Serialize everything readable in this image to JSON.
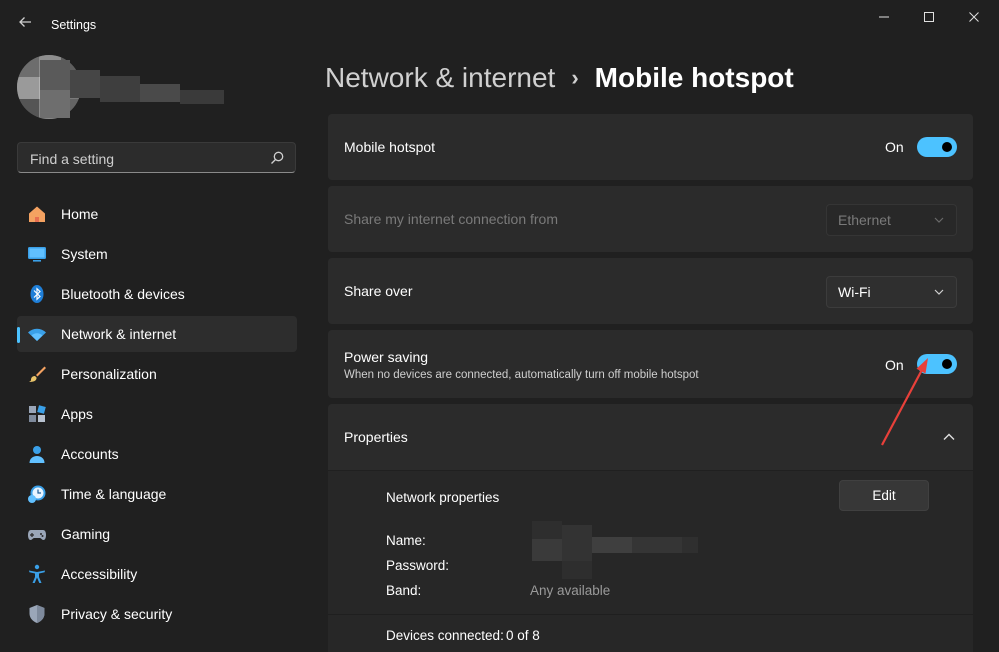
{
  "window": {
    "title": "Settings"
  },
  "search": {
    "placeholder": "Find a setting"
  },
  "sidebar": {
    "items": [
      {
        "label": "Home",
        "icon": "home-icon"
      },
      {
        "label": "System",
        "icon": "monitor-icon"
      },
      {
        "label": "Bluetooth & devices",
        "icon": "bluetooth-icon"
      },
      {
        "label": "Network & internet",
        "icon": "wifi-icon",
        "selected": true
      },
      {
        "label": "Personalization",
        "icon": "brush-icon"
      },
      {
        "label": "Apps",
        "icon": "apps-icon"
      },
      {
        "label": "Accounts",
        "icon": "person-icon"
      },
      {
        "label": "Time & language",
        "icon": "clock-globe-icon"
      },
      {
        "label": "Gaming",
        "icon": "gamepad-icon"
      },
      {
        "label": "Accessibility",
        "icon": "accessibility-icon"
      },
      {
        "label": "Privacy & security",
        "icon": "shield-icon"
      }
    ]
  },
  "breadcrumb": {
    "parent": "Network & internet",
    "separator": "›",
    "current": "Mobile hotspot"
  },
  "main": {
    "hotspot": {
      "label": "Mobile hotspot",
      "state": "On",
      "enabled": true
    },
    "share_from": {
      "label": "Share my internet connection from",
      "value": "Ethernet"
    },
    "share_over": {
      "label": "Share over",
      "value": "Wi-Fi"
    },
    "power_saving": {
      "label": "Power saving",
      "description": "When no devices are connected, automatically turn off mobile hotspot",
      "state": "On",
      "enabled": true
    },
    "properties": {
      "title": "Properties",
      "network_properties": "Network properties",
      "edit_label": "Edit",
      "name_label": "Name:",
      "password_label": "Password:",
      "band_label": "Band:",
      "band_value": "Any available",
      "devices_label": "Devices connected:",
      "devices_value": "0 of 8"
    }
  },
  "colors": {
    "accent": "#4cc2ff",
    "background": "#202020",
    "card": "#2b2b2b",
    "annotation_arrow": "#e8403a"
  }
}
